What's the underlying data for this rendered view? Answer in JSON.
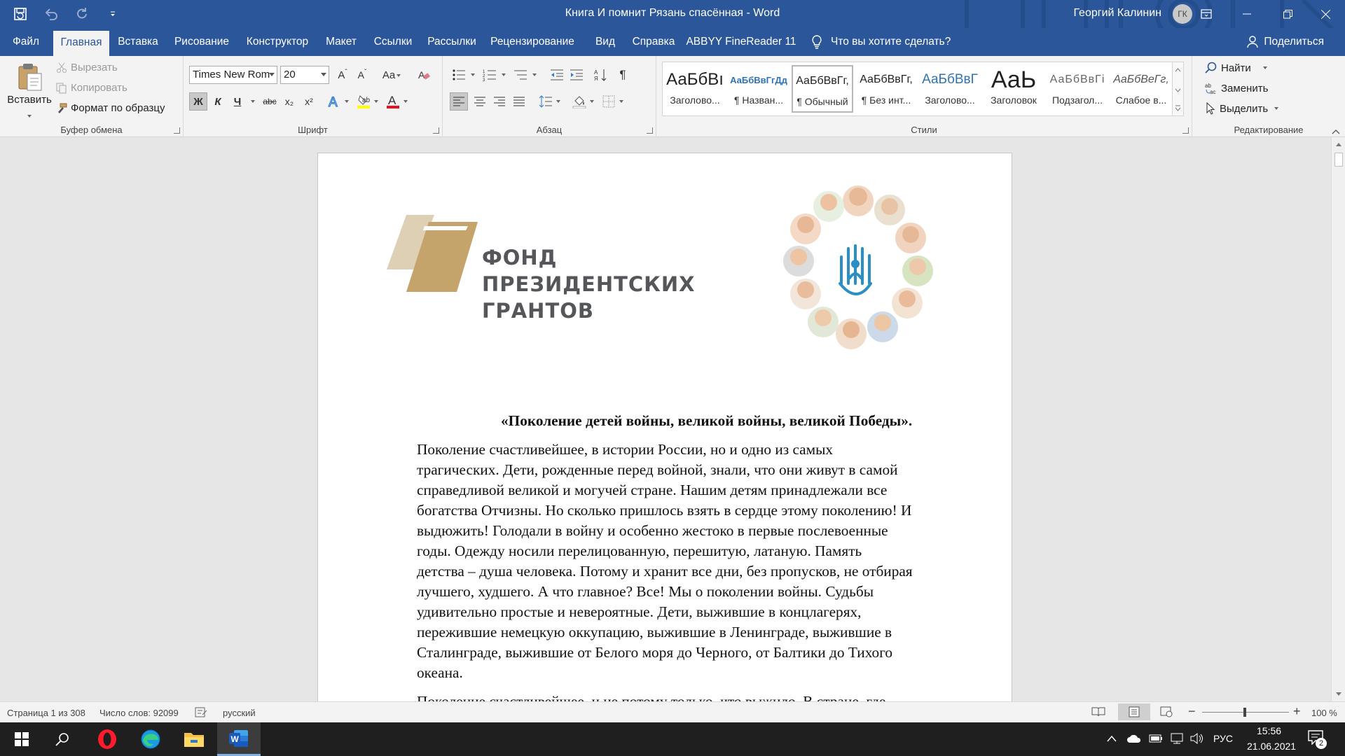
{
  "window": {
    "title": "Книга И помнит Рязань спасённая  -  Word",
    "user_name": "Георгий Калинин",
    "user_initials": "ГК"
  },
  "tabs": [
    {
      "label": "Файл"
    },
    {
      "label": "Главная"
    },
    {
      "label": "Вставка"
    },
    {
      "label": "Рисование"
    },
    {
      "label": "Конструктор"
    },
    {
      "label": "Макет"
    },
    {
      "label": "Ссылки"
    },
    {
      "label": "Рассылки"
    },
    {
      "label": "Рецензирование"
    },
    {
      "label": "Вид"
    },
    {
      "label": "Справка"
    },
    {
      "label": "ABBYY FineReader 11"
    }
  ],
  "tell_me": "Что вы хотите сделать?",
  "share_label": "Поделиться",
  "clipboard": {
    "paste": "Вставить",
    "cut": "Вырезать",
    "copy": "Копировать",
    "format_painter": "Формат по образцу",
    "group": "Буфер обмена"
  },
  "font": {
    "name": "Times New Rom",
    "size": "20",
    "group": "Шрифт",
    "bold_label": "Ж",
    "italic_label": "К",
    "underline_label": "Ч",
    "strike_label": "abc",
    "sub_label": "x₂",
    "sup_label": "x²",
    "case_label": "Aa"
  },
  "paragraph": {
    "group": "Абзац"
  },
  "styles": {
    "group": "Стили",
    "items": [
      {
        "sample": "АаБбВı",
        "name": "Заголово..."
      },
      {
        "sample": "АаБбВвГгДд",
        "name": "¶ Назван..."
      },
      {
        "sample": "АаБбВвГг,",
        "name": "¶ Обычный"
      },
      {
        "sample": "АаБбВвГг,",
        "name": "¶ Без инт..."
      },
      {
        "sample": "АаБбВвГ",
        "name": "Заголово..."
      },
      {
        "sample": "АаЬ",
        "name": "Заголовок"
      },
      {
        "sample": "АаБбВвГі",
        "name": "Подзагол..."
      },
      {
        "sample": "АаБбВеГг,",
        "name": "Слабое в..."
      }
    ]
  },
  "editing": {
    "find": "Найти",
    "replace": "Заменить",
    "select": "Выделить",
    "group": "Редактирование"
  },
  "document": {
    "logo_line1": "ФОНД",
    "logo_line2": "ПРЕЗИДЕНТСКИХ",
    "logo_line3": "ГРАНТОВ",
    "heading": "«Поколение детей войны, великой войны, великой Победы».",
    "paragraph1_lines": [
      "Поколение счастливейшее, в истории России, но и одно из самых",
      "трагических. Дети, рожденные перед войной, знали, что они живут в самой",
      "справедливой великой и могучей стране.  Нашим детям принадлежали все",
      "богатства Отчизны. Но сколько пришлось взять в сердце этому поколению! И",
      "выдюжить!  Голодали в войну и особенно жестоко в первые послевоенные",
      "годы. Одежду носили перелицованную, перешитую, латаную.  Память",
      "детства – душа человека. Потому и хранит все дни, без пропусков, не отбирая",
      "лучшего, худшего. А что главное? Все! Мы о поколении войны. Судьбы",
      "удивительно простые и невероятные. Дети, выжившие в концлагерях,",
      "пережившие немецкую оккупацию, выжившие в Ленинграде, выжившие в",
      "Сталинграде, выжившие от Белого моря до Черного, от Балтики до Тихого",
      "океана."
    ],
    "paragraph2_partial": "Поколение счастливейшее, и не потому только, что выжило. В стране, где"
  },
  "status": {
    "page": "Страница 1 из 308",
    "words": "Число слов: 92099",
    "language": "русский",
    "zoom": "100 %"
  },
  "tray": {
    "lang": "РУС",
    "time": "15:56",
    "date": "21.06.2021",
    "notif_count": "2"
  },
  "colors": {
    "word_blue": "#2b579a",
    "logo_gold": "#c4a46b",
    "logo_text": "#54565a"
  }
}
